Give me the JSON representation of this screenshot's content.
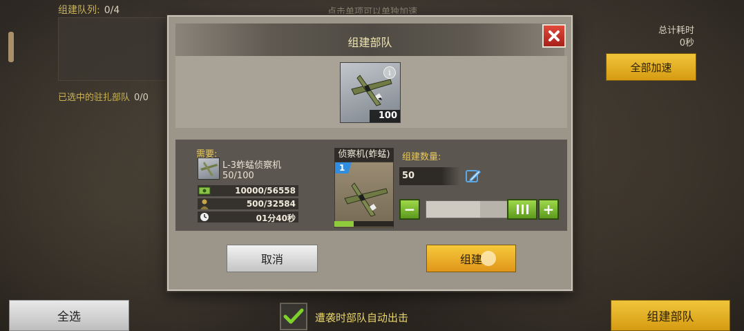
{
  "background": {
    "queue_label": "组建队列:",
    "queue_count": "0/4",
    "garrison_label": "已选中的驻扎部队",
    "garrison_count": "0/0",
    "hint": "点击单项可以单独加速",
    "total_time_label": "总计耗时",
    "total_time_value": "0秒",
    "speedup_all_label": "全部加速",
    "select_all_label": "全选",
    "auto_dispatch_label": "遭袭时部队自动出击",
    "auto_dispatch_checked": true,
    "build_troops_label": "组建部队"
  },
  "dialog": {
    "title": "组建部队",
    "unit_card": {
      "quantity": "100",
      "icon": "recon-plane-icon"
    },
    "requirements": {
      "label": "需要:",
      "item_name": "L-3蚱蜢侦察机",
      "item_have": "50/100",
      "resources": [
        {
          "icon": "cash-icon",
          "value": "10000/56558"
        },
        {
          "icon": "soldier-icon",
          "value": "500/32584"
        },
        {
          "icon": "clock-icon",
          "value": "01分40秒"
        }
      ]
    },
    "unit": {
      "name": "侦察机(蚱蜢)",
      "level": "1",
      "progress": 0.33
    },
    "build_count": {
      "label": "组建数量:",
      "value": "50",
      "slider_fraction": 0.5
    },
    "cancel_label": "取消",
    "build_label": "组建"
  },
  "colors": {
    "gold": "#e8c95a",
    "green": "#8fcb3a",
    "close_red": "#d03528"
  }
}
